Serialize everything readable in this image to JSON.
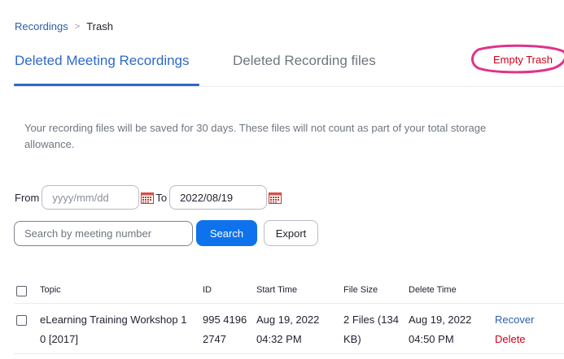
{
  "breadcrumb": {
    "parent": "Recordings",
    "separator": ">",
    "current": "Trash"
  },
  "tabs": [
    {
      "label": "Deleted Meeting Recordings",
      "active": true
    },
    {
      "label": "Deleted Recording files",
      "active": false
    }
  ],
  "actions": {
    "empty_trash": "Empty Trash"
  },
  "notice": "Your recording files will be saved for 30 days. These files will not count as part of your total storage allowance.",
  "filters": {
    "from_label": "From",
    "from_placeholder": "yyyy/mm/dd",
    "to_label": "To",
    "to_value": "2022/08/19"
  },
  "search": {
    "placeholder": "Search by meeting number",
    "search_label": "Search",
    "export_label": "Export"
  },
  "table": {
    "columns": [
      "Topic",
      "ID",
      "Start Time",
      "File Size",
      "Delete Time"
    ],
    "rows": [
      {
        "topic_line1": "eLearning Training Workshop 1",
        "topic_line2": "0 [2017]",
        "id_line1": "995 4196",
        "id_line2": "2747",
        "start_line1": "Aug 19, 2022",
        "start_line2": "04:32 PM",
        "size_line1": "2 Files (134",
        "size_line2": "KB)",
        "delete_line1": "Aug 19, 2022",
        "delete_line2": "04:50 PM",
        "recover_label": "Recover",
        "delete_label": "Delete"
      }
    ]
  },
  "colors": {
    "accent": "#0e72ed",
    "tab_active": "#2d69c9",
    "danger": "#d0021b",
    "highlight": "#e0338a"
  },
  "icons": [
    "calendar-icon",
    "checkbox"
  ]
}
